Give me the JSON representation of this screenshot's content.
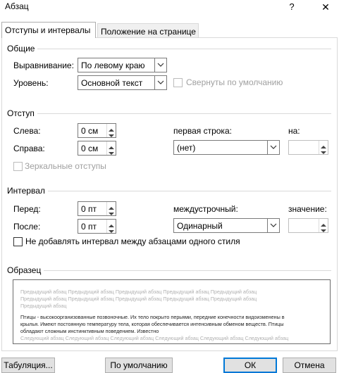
{
  "window": {
    "title": "Абзац",
    "help_glyph": "?",
    "close_glyph": "✕"
  },
  "tabs": [
    {
      "label": "Отступы и интервалы",
      "active": true
    },
    {
      "label": "Положение на странице",
      "active": false
    }
  ],
  "general": {
    "group_label": "Общие",
    "alignment_label": "Выравнивание:",
    "alignment_value": "По левому краю",
    "level_label": "Уровень:",
    "level_value": "Основной текст",
    "collapsed_label": "Свернуты по умолчанию"
  },
  "indent": {
    "group_label": "Отступ",
    "left_label": "Слева:",
    "left_value": "0 см",
    "right_label": "Справа:",
    "right_value": "0 см",
    "first_line_label": "первая строка:",
    "first_line_value": "(нет)",
    "by_label": "на:",
    "by_value": "",
    "mirror_label": "Зеркальные отступы"
  },
  "spacing": {
    "group_label": "Интервал",
    "before_label": "Перед:",
    "before_value": "0 пт",
    "after_label": "После:",
    "after_value": "0 пт",
    "line_spacing_label": "междустрочный:",
    "line_spacing_value": "Одинарный",
    "at_label": "значение:",
    "at_value": "",
    "dont_add_label": "Не добавлять интервал между абзацами одного стиля"
  },
  "preview": {
    "group_label": "Образец",
    "prev_lines": [
      "Предыдущий абзац Предыдущий абзац Предыдущий абзац Предыдущий абзац Предыдущий абзац",
      "Предыдущий абзац Предыдущий абзац Предыдущий абзац Предыдущий абзац Предыдущий абзац",
      "Предыдущий абзац"
    ],
    "main_lines": [
      "Птицы - высокоорганизованные позвоночные. Их тело покрыто перьями, передние конечности видоизменены в",
      "крылья. Имеют постоянную температуру тела, которая обеспечивается интенсивным обменом веществ. Птицы",
      "обладают сложным инстинктивным поведением. Известно",
      "Следующий абзац Следующий абзац Следующий абзац Следующий абзац Следующий абзац Следующий абзац"
    ]
  },
  "footer": {
    "tabs_button": "Табуляция...",
    "default_button": "По умолчанию",
    "ok_button": "ОК",
    "cancel_button": "Отмена"
  }
}
